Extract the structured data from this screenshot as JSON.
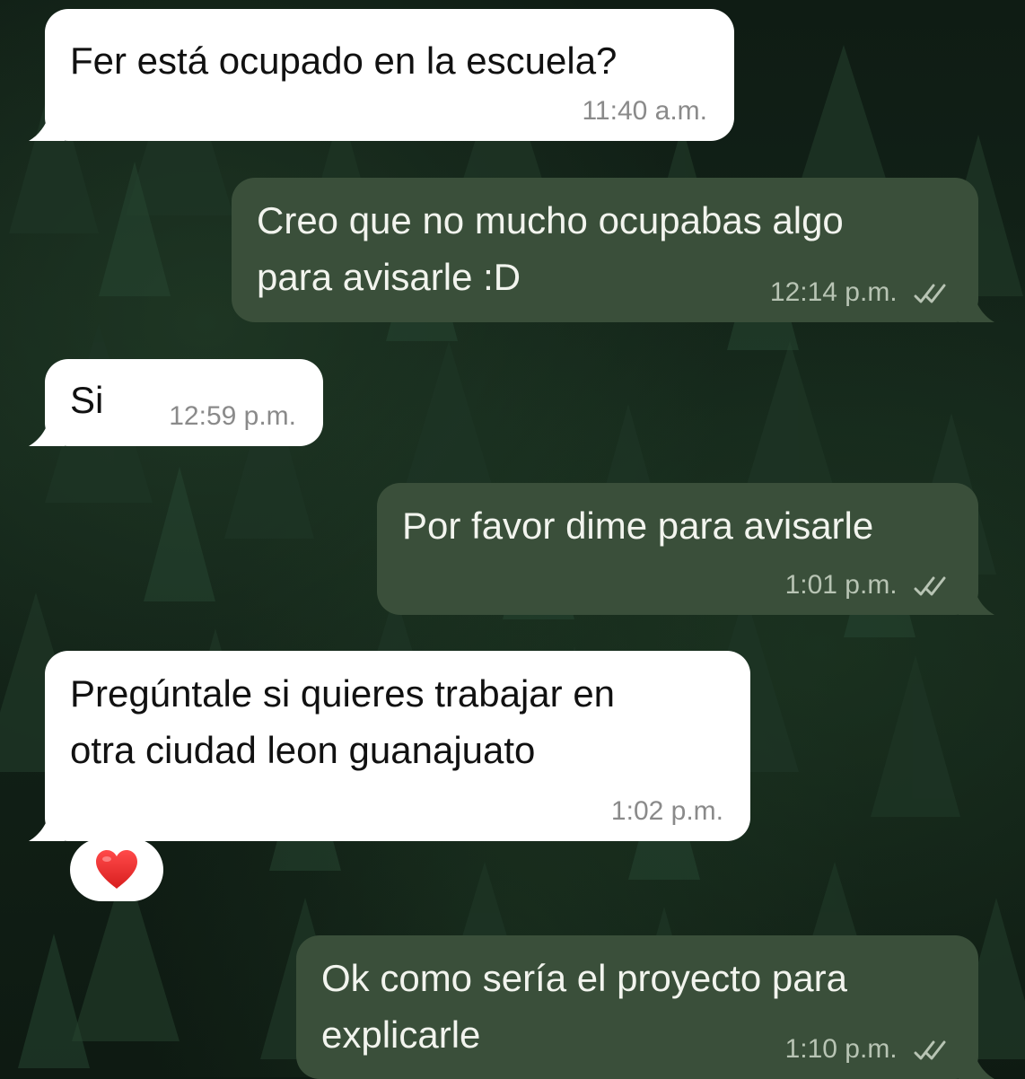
{
  "messages": [
    {
      "direction": "incoming",
      "text": "Fer está ocupado en la escuela?",
      "time": "11:40 a.m."
    },
    {
      "direction": "outgoing",
      "text": "Creo que no mucho ocupabas algo\npara avisarle :D",
      "time": "12:14 p.m.",
      "status": "read"
    },
    {
      "direction": "incoming",
      "text": "Si",
      "time": "12:59 p.m."
    },
    {
      "direction": "outgoing",
      "text": "Por favor dime para avisarle",
      "time": "1:01 p.m.",
      "status": "read"
    },
    {
      "direction": "incoming",
      "text": "Pregúntale si quieres trabajar en\notra ciudad leon guanajuato",
      "time": "1:02 p.m.",
      "reaction": "❤️"
    },
    {
      "direction": "outgoing",
      "text": "Ok como sería el proyecto para\nexplicarle",
      "time": "1:10 p.m.",
      "status": "read"
    }
  ],
  "icons": {
    "read_receipt": "double-check-icon",
    "reaction": "heart-icon"
  },
  "colors": {
    "incoming_bubble": "#ffffff",
    "outgoing_bubble": "#3a4f3a",
    "wallpaper": "#0f1c14"
  }
}
